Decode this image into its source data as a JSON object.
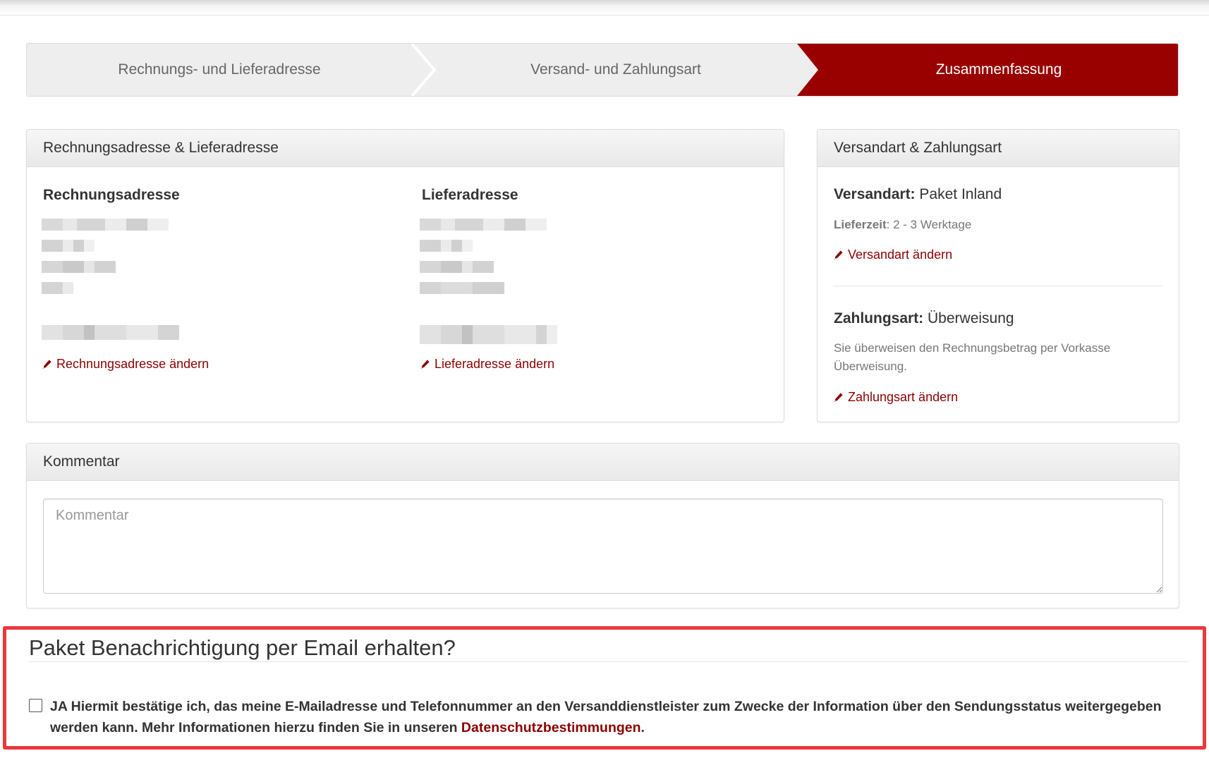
{
  "steps": [
    {
      "label": "Rechnungs- und Lieferadresse",
      "state": "done"
    },
    {
      "label": "Versand- und Zahlungsart",
      "state": "done"
    },
    {
      "label": "Zusammenfassung",
      "state": "active"
    }
  ],
  "address_panel": {
    "heading": "Rechnungsadresse & Lieferadresse",
    "billing": {
      "title": "Rechnungsadresse",
      "edit_link": "Rechnungsadresse ändern"
    },
    "shipping": {
      "title": "Lieferadresse",
      "edit_link": "Lieferadresse ändern"
    }
  },
  "shipping_payment_panel": {
    "heading": "Versandart & Zahlungsart",
    "shipping_label": "Versandart:",
    "shipping_value": "Paket Inland",
    "delivery_label": "Lieferzeit",
    "delivery_value": ": 2 - 3 Werktage",
    "shipping_edit": "Versandart ändern",
    "payment_label": "Zahlungsart:",
    "payment_value": "Überweisung",
    "payment_desc": "Sie überweisen den Rechnungsbetrag per Vorkasse Überweisung.",
    "payment_edit": "Zahlungsart ändern"
  },
  "comment_panel": {
    "heading": "Kommentar",
    "placeholder": "Kommentar"
  },
  "notification": {
    "title": "Paket Benachrichtigung per Email erhalten?",
    "consent_text": "JA Hiermit bestätige ich, das meine E-Mailadresse und Telefonnummer an den Versanddienstleister zum Zwecke der Information über den Sendungsstatus weitergegeben werden kann. Mehr Informationen hierzu finden Sie in unseren ",
    "privacy_link": "Datenschutzbestimmungen",
    "consent_end": ".",
    "checked": false
  },
  "colors": {
    "accent": "#8b0000",
    "step_active_bg": "#990000",
    "highlight_border": "#e8393d"
  },
  "icons": {
    "edit": "pencil-icon"
  }
}
